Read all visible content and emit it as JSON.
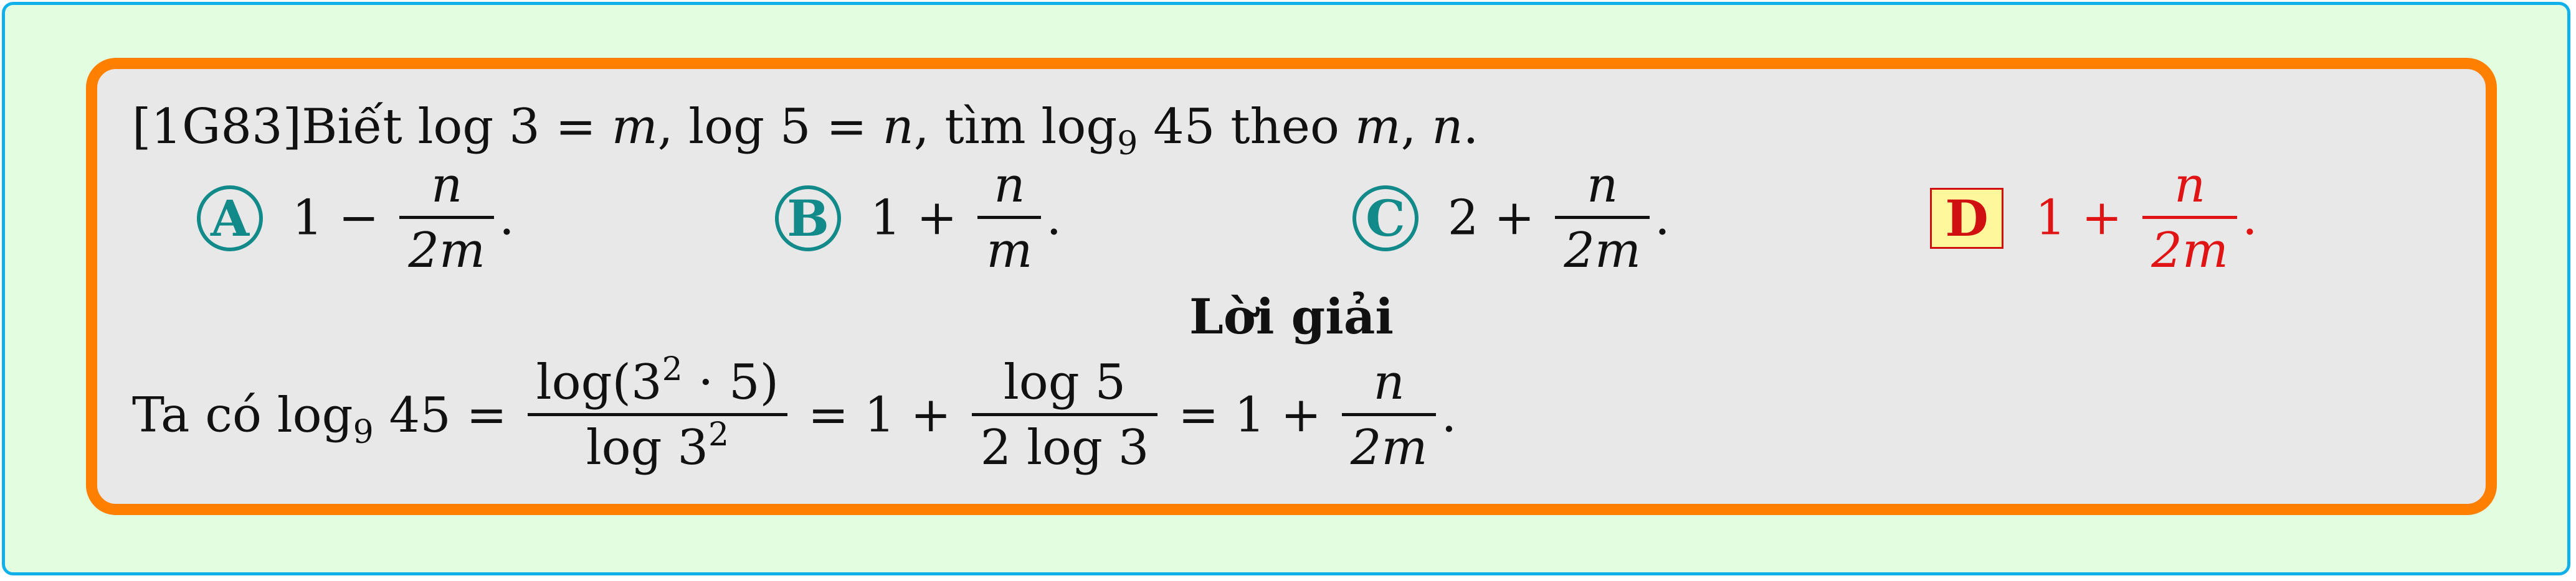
{
  "question": {
    "id": "[1G83]",
    "text_before": "Biết",
    "cond1_fn": "log",
    "cond1_arg": "3",
    "cond1_eq": "=",
    "cond1_var": "m",
    "sep1": ",",
    "cond2_fn": "log",
    "cond2_arg": "5",
    "cond2_eq": "=",
    "cond2_var": "n",
    "sep2": ",",
    "ask_word": "tìm",
    "target_fn": "log",
    "target_base": "9",
    "target_arg": "45",
    "theo": "theo",
    "var1": "m",
    "comma": ",",
    "var2": "n",
    "end": "."
  },
  "choices": [
    {
      "letter": "A",
      "lead": "1 −",
      "num": "n",
      "den": "2m",
      "end": "."
    },
    {
      "letter": "B",
      "lead": "1 +",
      "num": "n",
      "den": "m",
      "end": "."
    },
    {
      "letter": "C",
      "lead": "2 +",
      "num": "n",
      "den": "2m",
      "end": "."
    },
    {
      "letter": "D",
      "lead": "1 +",
      "num": "n",
      "den": "2m",
      "end": "."
    }
  ],
  "correct_choice": "D",
  "solution": {
    "heading": "Lời giải",
    "prefix": "Ta có",
    "lhs_fn": "log",
    "lhs_base": "9",
    "lhs_arg": "45",
    "eq1": "=",
    "f1_num_fn": "log(3",
    "f1_num_exp": "2",
    "f1_num_rest": " · 5)",
    "f1_den_fn": "log 3",
    "f1_den_exp": "2",
    "eq2": "= 1 +",
    "f2_num": "log 5",
    "f2_den": "2 log 3",
    "eq3": "= 1 +",
    "f3_num": "n",
    "f3_den": "2m",
    "end": "."
  },
  "colors": {
    "outer_border": "#12b0e8",
    "outer_fill": "#e2fde0",
    "inner_border": "#ff8000",
    "inner_fill": "#e8e8e8",
    "choice_badge": "#138a8a",
    "correct_text": "#e01414",
    "correct_badge_fill": "#fff79c"
  }
}
